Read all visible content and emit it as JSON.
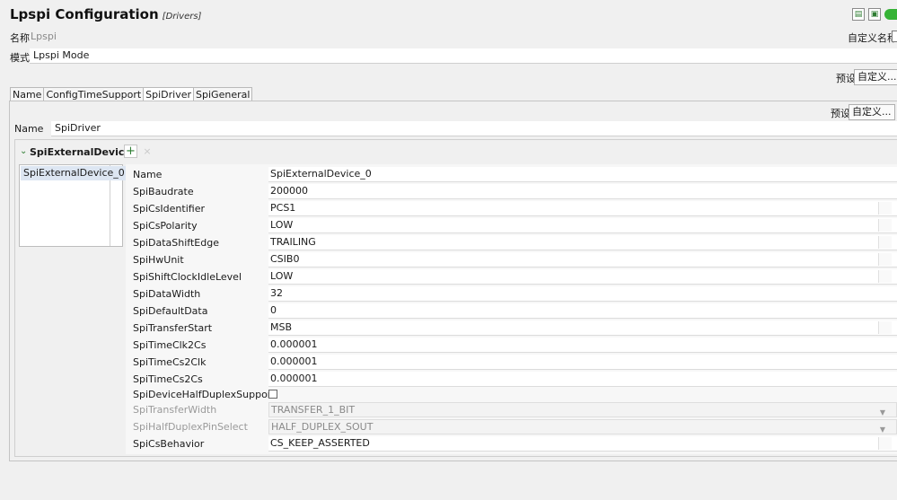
{
  "header": {
    "title": "Lpspi Configuration",
    "subtitle": "[Drivers]",
    "name_label": "名称",
    "name_value": "Lpspi",
    "custom_name_label": "自定义名称",
    "mode_label": "模式",
    "mode_value": "Lpspi Mode",
    "preset_label": "预设",
    "preset_button": "自定义..."
  },
  "tabs": [
    "Name",
    "ConfigTimeSupport",
    "SpiDriver",
    "SpiGeneral"
  ],
  "active_tab": "SpiDriver",
  "driver": {
    "name_label": "Name",
    "name_value": "SpiDriver",
    "preset_label": "预设",
    "preset_button": "自定义..."
  },
  "section": {
    "title": "SpiExternalDevice",
    "add_symbol": "+",
    "remove_symbol": "×",
    "list_items": [
      "SpiExternalDevice_0"
    ]
  },
  "properties": [
    {
      "label": "Name",
      "value": "SpiExternalDevice_0"
    },
    {
      "label": "SpiBaudrate",
      "value": "200000"
    },
    {
      "label": "SpiCsIdentifier",
      "value": "PCS1"
    },
    {
      "label": "SpiCsPolarity",
      "value": "LOW"
    },
    {
      "label": "SpiDataShiftEdge",
      "value": "TRAILING"
    },
    {
      "label": "SpiHwUnit",
      "value": "CSIB0"
    },
    {
      "label": "SpiShiftClockIdleLevel",
      "value": "LOW"
    },
    {
      "label": "SpiDataWidth",
      "value": "32"
    },
    {
      "label": "SpiDefaultData",
      "value": "0"
    },
    {
      "label": "SpiTransferStart",
      "value": "MSB"
    },
    {
      "label": "SpiTimeClk2Cs",
      "value": "0.000001"
    },
    {
      "label": "SpiTimeCs2Clk",
      "value": "0.000001"
    },
    {
      "label": "SpiTimeCs2Cs",
      "value": "0.000001"
    },
    {
      "label": "SpiDeviceHalfDuplexSupport",
      "value": ""
    },
    {
      "label": "SpiTransferWidth",
      "value": "TRANSFER_1_BIT"
    },
    {
      "label": "SpiHalfDuplexPinSelect",
      "value": "HALF_DUPLEX_SOUT"
    },
    {
      "label": "SpiCsBehavior",
      "value": "CS_KEEP_ASSERTED"
    }
  ],
  "colors": {
    "accent_green": "#36b336",
    "selection": "#dde6f2"
  }
}
